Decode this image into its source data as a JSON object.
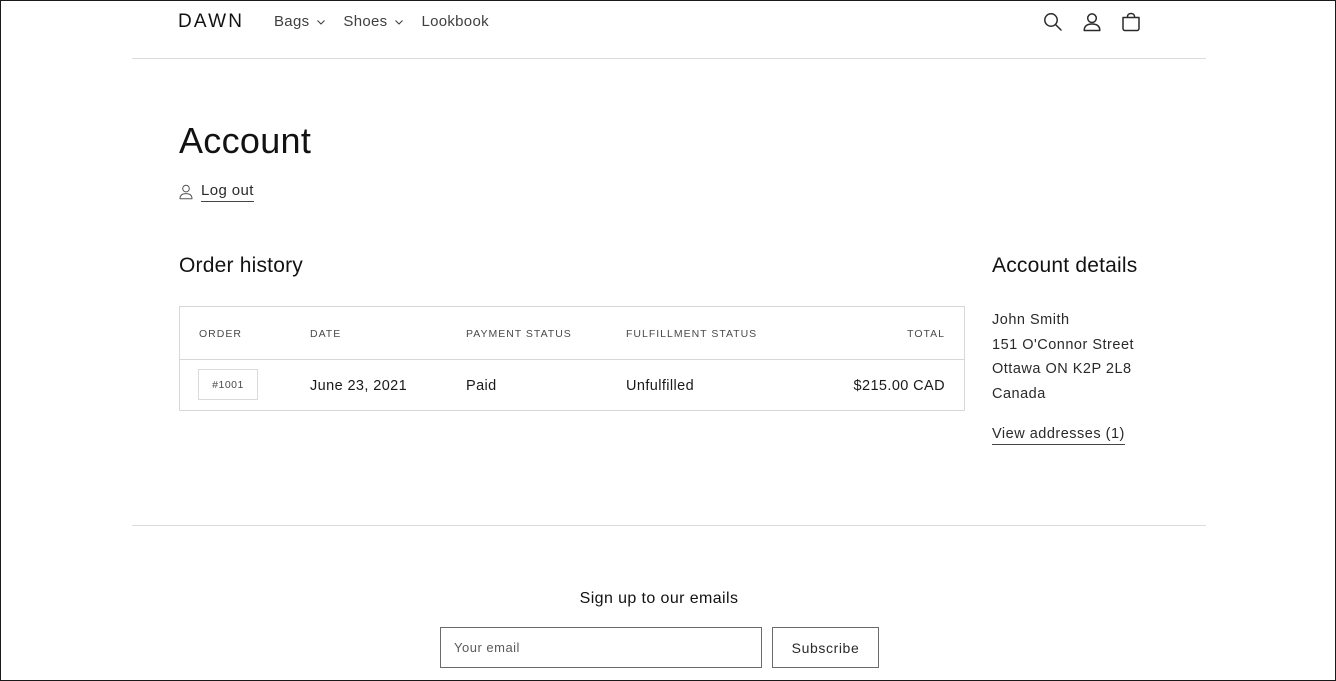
{
  "header": {
    "logo": "DAWN",
    "nav": [
      {
        "label": "Bags",
        "has_dropdown": true
      },
      {
        "label": "Shoes",
        "has_dropdown": true
      },
      {
        "label": "Lookbook",
        "has_dropdown": false
      }
    ],
    "icons": [
      "search-icon",
      "account-icon",
      "cart-icon"
    ]
  },
  "account": {
    "title": "Account",
    "logout_label": "Log out"
  },
  "orders": {
    "title": "Order history",
    "columns": [
      "Order",
      "Date",
      "Payment status",
      "Fulfillment status",
      "Total"
    ],
    "rows": [
      {
        "order": "#1001",
        "date": "June 23, 2021",
        "payment": "Paid",
        "fulfillment": "Unfulfilled",
        "total": "$215.00 CAD"
      }
    ]
  },
  "details": {
    "title": "Account details",
    "name": "John Smith",
    "street": "151 O'Connor Street",
    "city_line": "Ottawa ON K2P 2L8",
    "country": "Canada",
    "view_addresses": "View addresses (1)"
  },
  "footer": {
    "signup_title": "Sign up to our emails",
    "email_placeholder": "Your email",
    "subscribe_label": "Subscribe"
  },
  "colors": {
    "text": "#121212",
    "border": "#d8d8d8",
    "divider": "#dcdcdc"
  }
}
